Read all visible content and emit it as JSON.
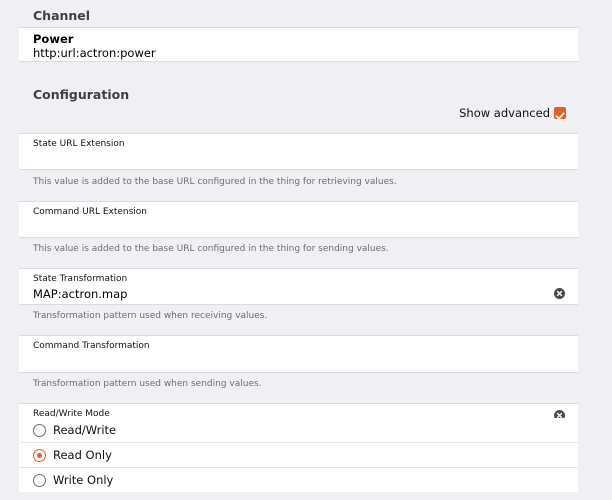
{
  "channel": {
    "heading": "Channel",
    "name": "Power",
    "uid": "http:url:actron:power"
  },
  "configuration": {
    "heading": "Configuration",
    "show_advanced_label": "Show advanced",
    "show_advanced_checked": true
  },
  "fields": {
    "state_url_extension": {
      "label": "State URL Extension",
      "value": "",
      "description": "This value is added to the base URL configured in the thing for retrieving values."
    },
    "command_url_extension": {
      "label": "Command URL Extension",
      "value": "",
      "description": "This value is added to the base URL configured in the thing for sending values."
    },
    "state_transformation": {
      "label": "State Transformation",
      "value": "MAP:actron.map",
      "description": "Transformation pattern used when receiving values."
    },
    "command_transformation": {
      "label": "Command Transformation",
      "value": "",
      "description": "Transformation pattern used when sending values."
    },
    "read_write_mode": {
      "label": "Read/Write Mode",
      "options": [
        "Read/Write",
        "Read Only",
        "Write Only"
      ],
      "selected": "Read Only"
    }
  },
  "colors": {
    "accent": "#e85d2a",
    "background": "#efeff4",
    "card": "#ffffff",
    "hint": "#6d6d72"
  },
  "icons": {
    "clear": "clear-icon",
    "checkbox": "checkbox-checked-icon"
  }
}
